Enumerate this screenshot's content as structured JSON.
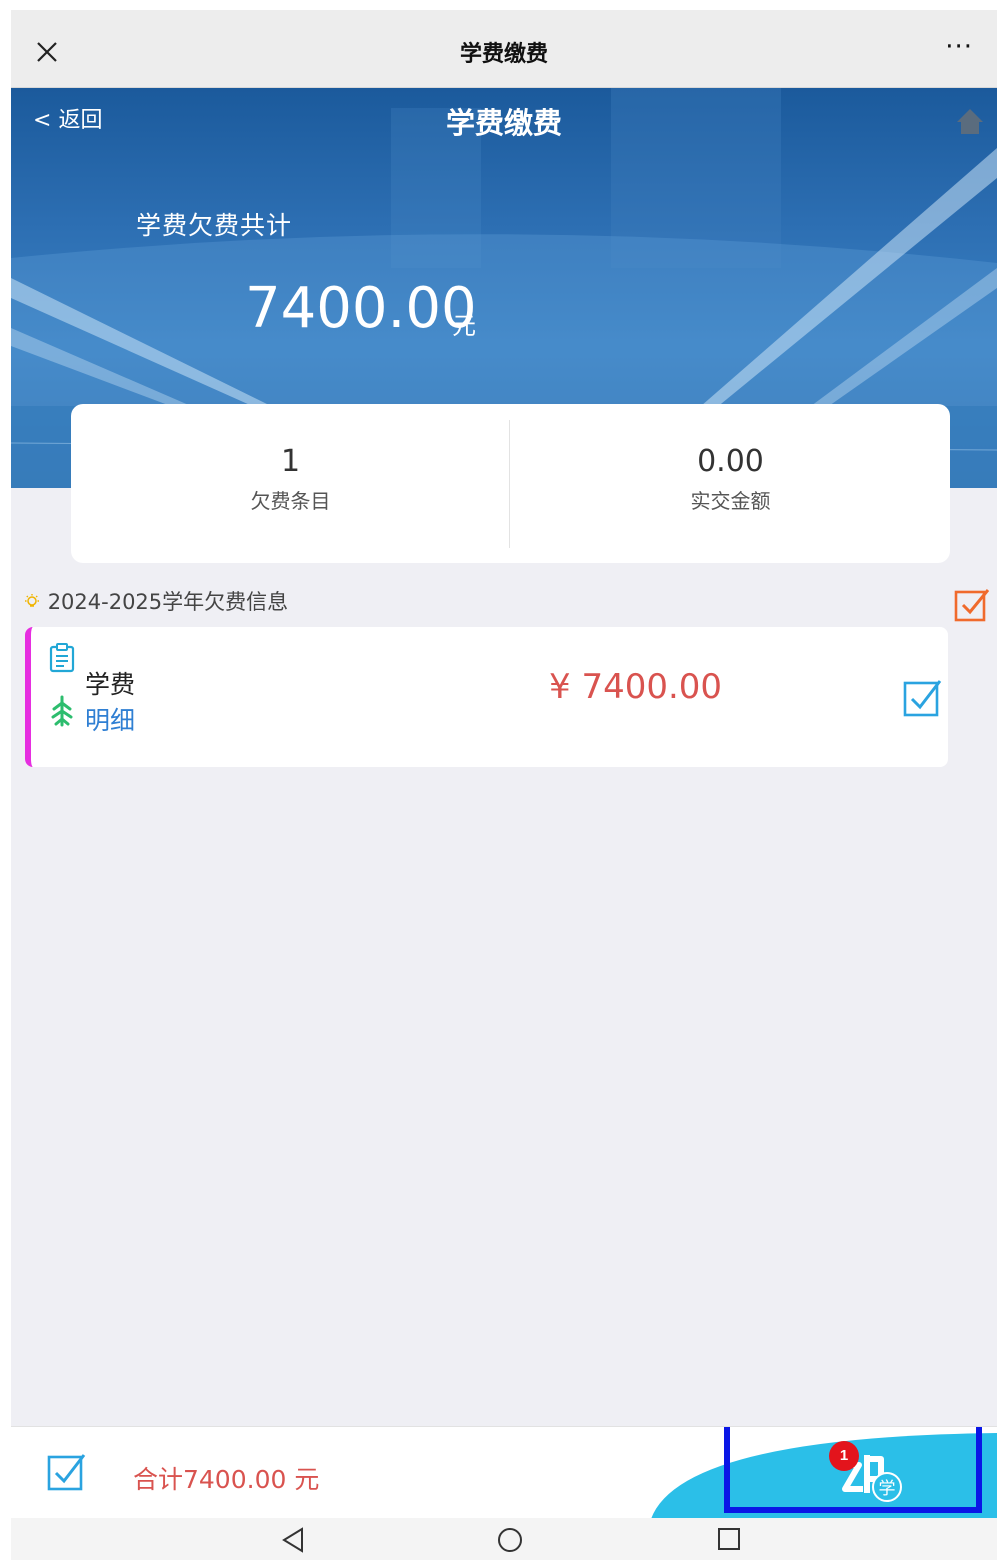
{
  "topbar": {
    "title": "学费缴费",
    "more": "···"
  },
  "banner": {
    "back_label": "返回",
    "back_arrow": "<",
    "title": "学费缴费",
    "owed_label": "学费欠费共计",
    "owed_amount": "7400.00",
    "owed_unit": "元"
  },
  "summary": {
    "items_count": "1",
    "items_label": "欠费条目",
    "paid_amount": "0.00",
    "paid_label": "实交金额"
  },
  "section": {
    "title": "2024-2025学年欠费信息",
    "select_all_checked": true
  },
  "fee_items": [
    {
      "name": "学费",
      "detail_link": "明细",
      "price": "¥ 7400.00",
      "checked": true
    }
  ],
  "bottombar": {
    "total_label": "合计7400.00  元",
    "badge_count": "1",
    "pay_logo_char": "学"
  },
  "colors": {
    "accent_blue": "#2f7fd3",
    "price_red": "#d9534f",
    "item_stripe": "#e62ee0",
    "pay_cyan": "#2bbfe8",
    "highlight_border": "#0a16e6"
  },
  "icons": {
    "close": "close-icon",
    "more": "more-icon",
    "home": "home-icon",
    "bulb": "lightbulb-icon",
    "doc": "document-icon",
    "detail": "tree-icon",
    "check": "checkbox-checked-icon",
    "nav_back": "triangle-back-icon",
    "nav_home": "circle-home-icon",
    "nav_recent": "square-recent-icon"
  }
}
